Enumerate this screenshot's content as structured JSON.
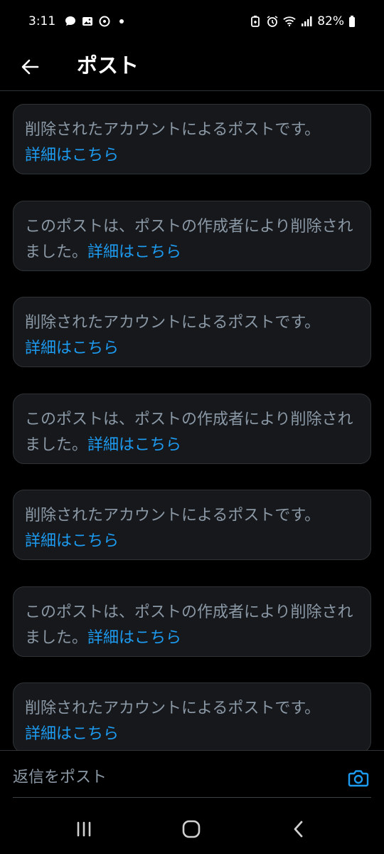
{
  "status_bar": {
    "time": "3:11",
    "battery": "82%",
    "left_icons": [
      "chat-bubble-icon",
      "image-icon",
      "sync-icon"
    ],
    "right_icons": [
      "battery-saver-icon",
      "alarm-icon",
      "wifi-icon",
      "signal-icon",
      "battery-icon"
    ]
  },
  "header": {
    "title": "ポスト",
    "back_icon": "back-arrow-icon"
  },
  "posts": [
    {
      "text": "削除されたアカウントによるポストです。",
      "link": "詳細はこちら"
    },
    {
      "text": "このポストは、ポストの作成者により削除されました。",
      "link": "詳細はこちら"
    },
    {
      "text": "削除されたアカウントによるポストです。",
      "link": "詳細はこちら"
    },
    {
      "text": "このポストは、ポストの作成者により削除されました。",
      "link": "詳細はこちら"
    },
    {
      "text": "削除されたアカウントによるポストです。",
      "link": "詳細はこちら"
    },
    {
      "text": "このポストは、ポストの作成者により削除されました。",
      "link": "詳細はこちら"
    },
    {
      "text": "削除されたアカウントによるポストです。",
      "link": "詳細はこちら"
    }
  ],
  "reply": {
    "placeholder": "返信をポスト",
    "value": "",
    "camera_icon": "camera-icon"
  },
  "nav_bar": {
    "icons": [
      "recent-apps-icon",
      "home-icon",
      "back-icon"
    ]
  },
  "colors": {
    "background": "#000000",
    "card_background": "#16181c",
    "card_border": "#2f3336",
    "muted_text": "#8b98a5",
    "link": "#1d9bf0"
  }
}
